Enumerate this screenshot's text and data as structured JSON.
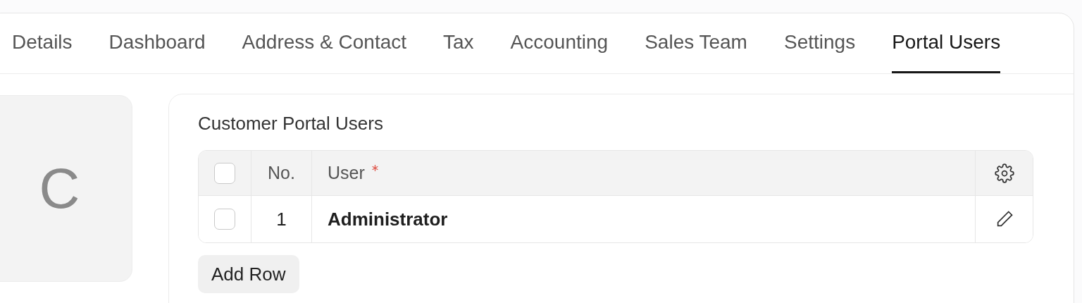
{
  "tabs": [
    {
      "label": "Details",
      "selected": false
    },
    {
      "label": "Dashboard",
      "selected": false
    },
    {
      "label": "Address & Contact",
      "selected": false
    },
    {
      "label": "Tax",
      "selected": false
    },
    {
      "label": "Accounting",
      "selected": false
    },
    {
      "label": "Sales Team",
      "selected": false
    },
    {
      "label": "Settings",
      "selected": false
    },
    {
      "label": "Portal Users",
      "selected": true
    }
  ],
  "avatar": {
    "initial": "C"
  },
  "section": {
    "title": "Customer Portal Users",
    "table": {
      "select_all": {
        "checked": false
      },
      "columns": [
        {
          "label": "No."
        },
        {
          "label": "User",
          "required": true
        }
      ],
      "rows": [
        {
          "checked": false,
          "no": "1",
          "user": "Administrator"
        }
      ]
    },
    "add_button": "Add Row"
  }
}
